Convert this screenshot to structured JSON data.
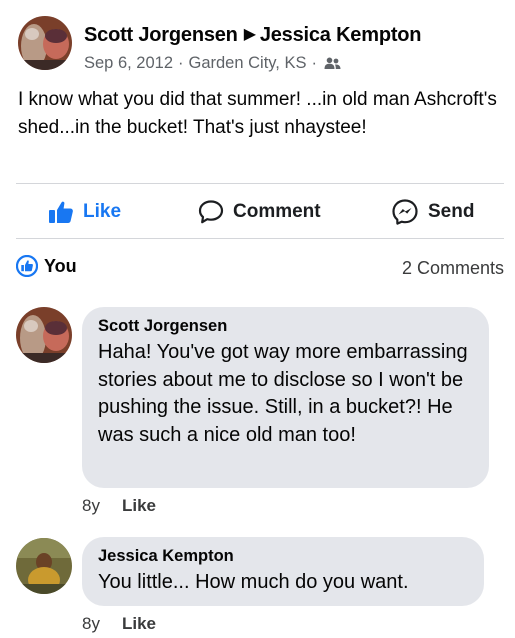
{
  "post": {
    "author": "Scott Jorgensen",
    "target": "Jessica Kempton",
    "date": "Sep 6, 2012",
    "location": "Garden City, KS",
    "audience_icon": "friends-icon",
    "text": "I know what you did that summer! ...in old man Ashcroft's shed...in the bucket! That's just nhaystee!"
  },
  "actions": {
    "like_label": "Like",
    "comment_label": "Comment",
    "send_label": "Send"
  },
  "reactions": {
    "who": "You",
    "comment_count": "2 Comments"
  },
  "comments": [
    {
      "author": "Scott Jorgensen",
      "text": "Haha! You've got way more embarrassing stories about me to disclose so I won't be pushing the issue. Still, in a bucket?! He was such a nice old man too!",
      "time": "8y",
      "like_label": "Like"
    },
    {
      "author": "Jessica Kempton",
      "text": "You little... How much do you want.",
      "time": "8y",
      "like_label": "Like"
    }
  ],
  "colors": {
    "accent": "#1877f2",
    "bubble": "#e4e6eb",
    "secondary_text": "#5f6368"
  }
}
